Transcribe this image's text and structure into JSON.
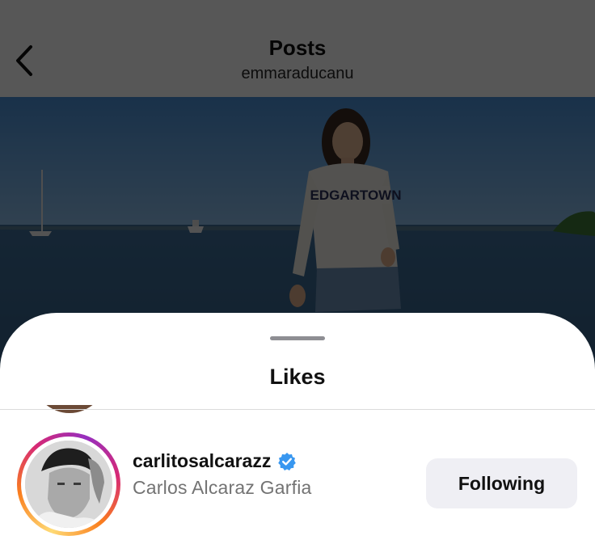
{
  "header": {
    "title": "Posts",
    "username": "emmaraducanu"
  },
  "post": {
    "sweater_text": "EDGARTOWN"
  },
  "likes_sheet": {
    "title": "Likes",
    "users": [
      {
        "username": "carlitosalcarazz",
        "full_name": "Carlos Alcaraz Garfia",
        "verified": true,
        "follow_label": "Following"
      }
    ]
  },
  "colors": {
    "verified_badge": "#3897f0",
    "button_bg": "#efeff4",
    "secondary_text": "#737373",
    "story_ring": [
      "#feda75",
      "#fa7e1e",
      "#d62976",
      "#962fbf"
    ]
  },
  "icons": {
    "back": "chevron-left-icon",
    "verified": "verified-badge-icon"
  }
}
